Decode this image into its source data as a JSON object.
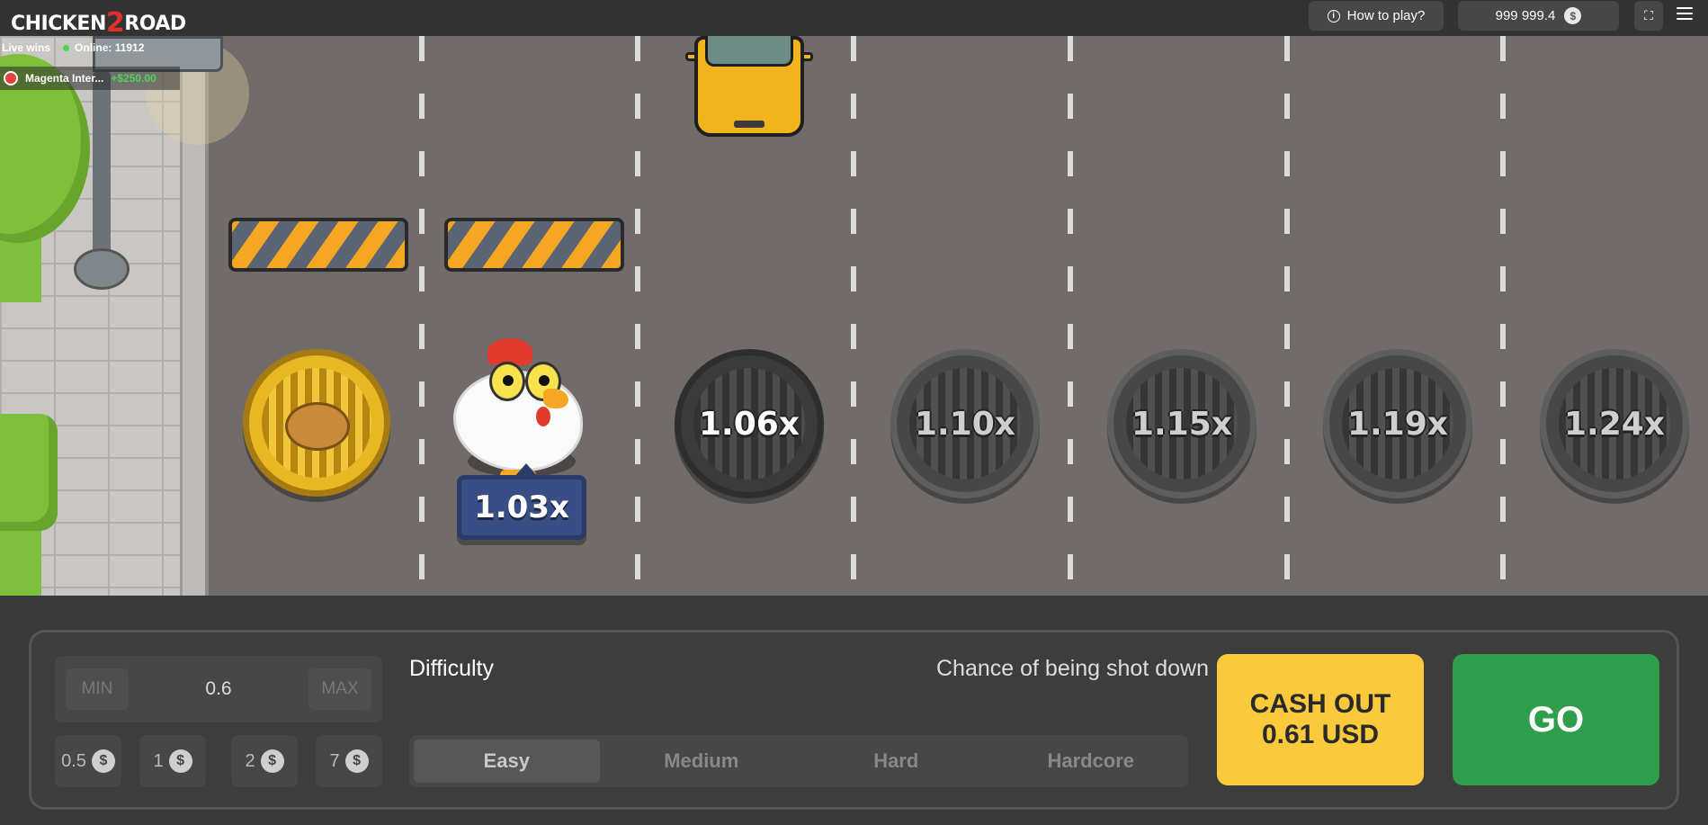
{
  "header": {
    "logo_prefix": "CHICKEN",
    "logo_two": "2",
    "logo_suffix": "ROAD",
    "how_to_play": "How to play?",
    "balance": "999 999.4",
    "currency_icon": "dollar-coin-icon"
  },
  "live_wins": {
    "label": "Live wins",
    "online": "Online: 11912",
    "player": "Magenta Inter...",
    "amount": "+$250.00"
  },
  "board": {
    "current_multiplier": "1.03x",
    "multipliers": [
      "1.06x",
      "1.10x",
      "1.15x",
      "1.19x",
      "1.24x"
    ]
  },
  "controls": {
    "min_label": "MIN",
    "max_label": "MAX",
    "bet_value": "0.6",
    "quick_bets": [
      "0.5",
      "1",
      "2",
      "7"
    ],
    "difficulty_label": "Difficulty",
    "chance_label": "Chance of being shot down",
    "difficulties": [
      "Easy",
      "Medium",
      "Hard",
      "Hardcore"
    ],
    "selected_difficulty": "Easy",
    "cashout_line1": "CASH OUT",
    "cashout_line2": "0.61 USD",
    "go_label": "GO"
  },
  "colors": {
    "cashout": "#fbc93c",
    "go": "#2f9e4b",
    "road": "#716c6a",
    "multiplier_badge": "#3a4e86"
  }
}
